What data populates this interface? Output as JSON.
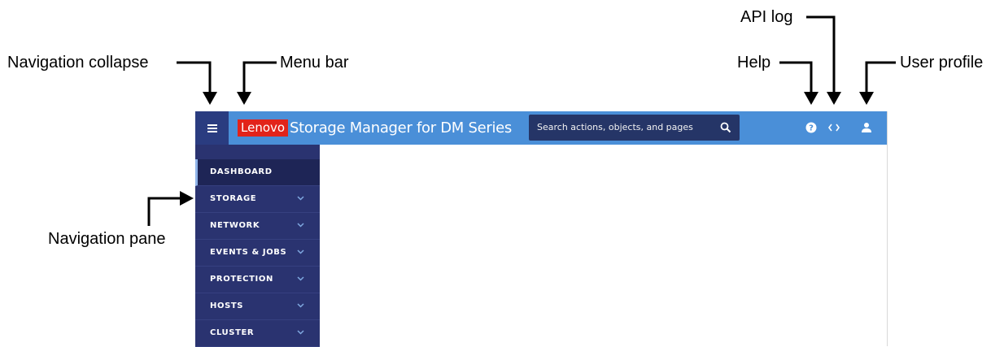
{
  "callouts": {
    "navigation_collapse": "Navigation collapse",
    "menu_bar": "Menu bar",
    "api_log": "API log",
    "help": "Help",
    "user_profile": "User profile",
    "navigation_pane": "Navigation pane"
  },
  "app": {
    "brand": "Lenovo",
    "title": "Storage Manager for DM Series",
    "search": {
      "placeholder": "Search actions, objects, and pages"
    },
    "icons": [
      "menu-icon",
      "search-icon",
      "help-icon",
      "code-icon",
      "user-icon",
      "chevron-down-icon"
    ],
    "colors": {
      "header": "#4a8fd8",
      "collapse": "#2a3c80",
      "sidebar": "#2a3370",
      "active_item": "#1e2556",
      "brand": "#e2231a",
      "search_bg": "#253567"
    }
  },
  "sidebar": {
    "items": [
      {
        "label": "DASHBOARD",
        "active": true
      },
      {
        "label": "STORAGE"
      },
      {
        "label": "NETWORK"
      },
      {
        "label": "EVENTS & JOBS"
      },
      {
        "label": "PROTECTION"
      },
      {
        "label": "HOSTS"
      },
      {
        "label": "CLUSTER"
      }
    ]
  }
}
